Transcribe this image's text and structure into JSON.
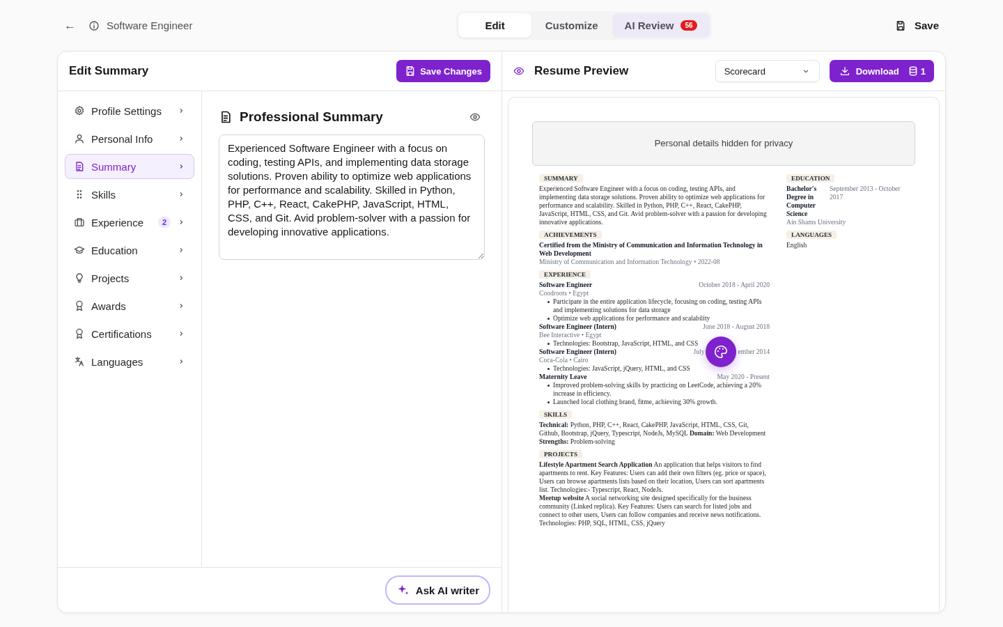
{
  "topbar": {
    "back": "←",
    "title": "Software Engineer",
    "save": "Save"
  },
  "tabs": [
    {
      "label": "Edit",
      "selected": true
    },
    {
      "label": "Customize",
      "selected": false
    },
    {
      "label": "AI Review",
      "selected": false,
      "badge": "56"
    }
  ],
  "editor": {
    "title": "Edit Summary",
    "save_button": "Save Changes",
    "sidebar": [
      {
        "label": "Profile Settings",
        "selected": false
      },
      {
        "label": "Personal Info",
        "selected": false
      },
      {
        "label": "Summary",
        "selected": true
      },
      {
        "label": "Skills",
        "selected": false
      },
      {
        "label": "Experience",
        "selected": false,
        "badge": "2"
      },
      {
        "label": "Education",
        "selected": false
      },
      {
        "label": "Projects",
        "selected": false
      },
      {
        "label": "Awards",
        "selected": false
      },
      {
        "label": "Certifications",
        "selected": false
      },
      {
        "label": "Languages",
        "selected": false
      }
    ],
    "section_title": "Professional Summary",
    "summary": "Experienced Software Engineer with a focus on coding, testing APIs, and implementing data storage solutions. Proven ability to optimize web applications for performance and scalability. Skilled in Python, PHP, C++, React, CakePHP, JavaScript, HTML, CSS, and Git. Avid problem-solver with a passion for developing innovative applications.",
    "ai_button": "Ask AI writer"
  },
  "preview": {
    "title": "Resume Preview",
    "template": "Scorecard",
    "download": "Download",
    "credits": "1",
    "privacy_notice": "Personal details hidden for privacy",
    "left": [
      {
        "heading": "SUMMARY",
        "kind": "text",
        "text": "Experienced Software Engineer with a focus on coding, testing APIs, and implementing data storage solutions. Proven ability to optimize web applications for performance and scalability. Skilled in Python, PHP, C++, React, CakePHP, JavaScript, HTML, CSS, and Git. Avid problem-solver with a passion for developing innovative applications."
      },
      {
        "heading": "ACHIEVEMENTS",
        "kind": "entries",
        "items": [
          {
            "title": "Certified from the Ministry of Communication and Information Technology in Web Development",
            "subtitle": "Ministry of Communication and Information Technology • 2022-08"
          }
        ]
      },
      {
        "heading": "EXPERIENCE",
        "kind": "jobs",
        "items": [
          {
            "title": "Software Engineer",
            "date": "October 2018 - April 2020",
            "company": "Coodroots • Egypt",
            "bullets": [
              "Participate in the entire application lifecycle, focusing on coding, testing APIs and implementing solutions for data storage",
              "Optimize web applications for performance and scalability"
            ]
          },
          {
            "title": "Software Engineer (Intern)",
            "date": "June 2018 - August 2018",
            "company": "Bee Interactive • Egypt",
            "bullets": [
              "Technologies: Bootstrap, JavaScript, HTML, and CSS"
            ]
          },
          {
            "title": "Software Engineer (Intern)",
            "date_parts": [
              "July",
              "ember 2014"
            ],
            "company": "Coca-Cola • Cairo",
            "bullets": [
              "Technologies: JavaScript, jQuery, HTML, and CSS"
            ]
          },
          {
            "title": "Maternity Leave",
            "date": "May 2020 - Present",
            "bullets": [
              "Improved problem-solving skills by practicing on LeetCode, achieving a 20% increase in efficiency.",
              "Launched local clothing brand, fitme, achieving 30% growth."
            ]
          }
        ]
      },
      {
        "heading": "SKILLS",
        "kind": "rich",
        "paragraphs": [
          "**Technical:** Python, PHP, C++, React, CakePHP, JavaScript, HTML, CSS, Git, Github, Bootstrap, jQuery, Typescript, NodeJs, MySQL **Domain:** Web Development **Strengths:** Problem-solving"
        ]
      },
      {
        "heading": "PROJECTS",
        "kind": "rich",
        "paragraphs": [
          "**Lifestyle Apartment Search Application** An application that helps visitors to find apartments to rent. Key Features: Users can add their own filters (eg. price or space), Users can browse apartments lists based on their location, Users can sort apartments list. Technologies:- Typescript, React, NodeJs.",
          "**Meetup website** A social networking site designed specifically for the business community (Linked replica). Key Features: Users can search for listed jobs and connect to other users, Users can follow companies and receive news notifications. Technologies: PHP, SQL, HTML, CSS, jQuery"
        ]
      }
    ],
    "right": [
      {
        "heading": "EDUCATION",
        "kind": "education",
        "items": [
          {
            "degree": "Bachelor's Degree in Computer Science",
            "date": "September 2013 - October 2017",
            "school": "Ain Shams University"
          }
        ]
      },
      {
        "heading": "LANGUAGES",
        "kind": "text",
        "text": "English"
      }
    ]
  }
}
